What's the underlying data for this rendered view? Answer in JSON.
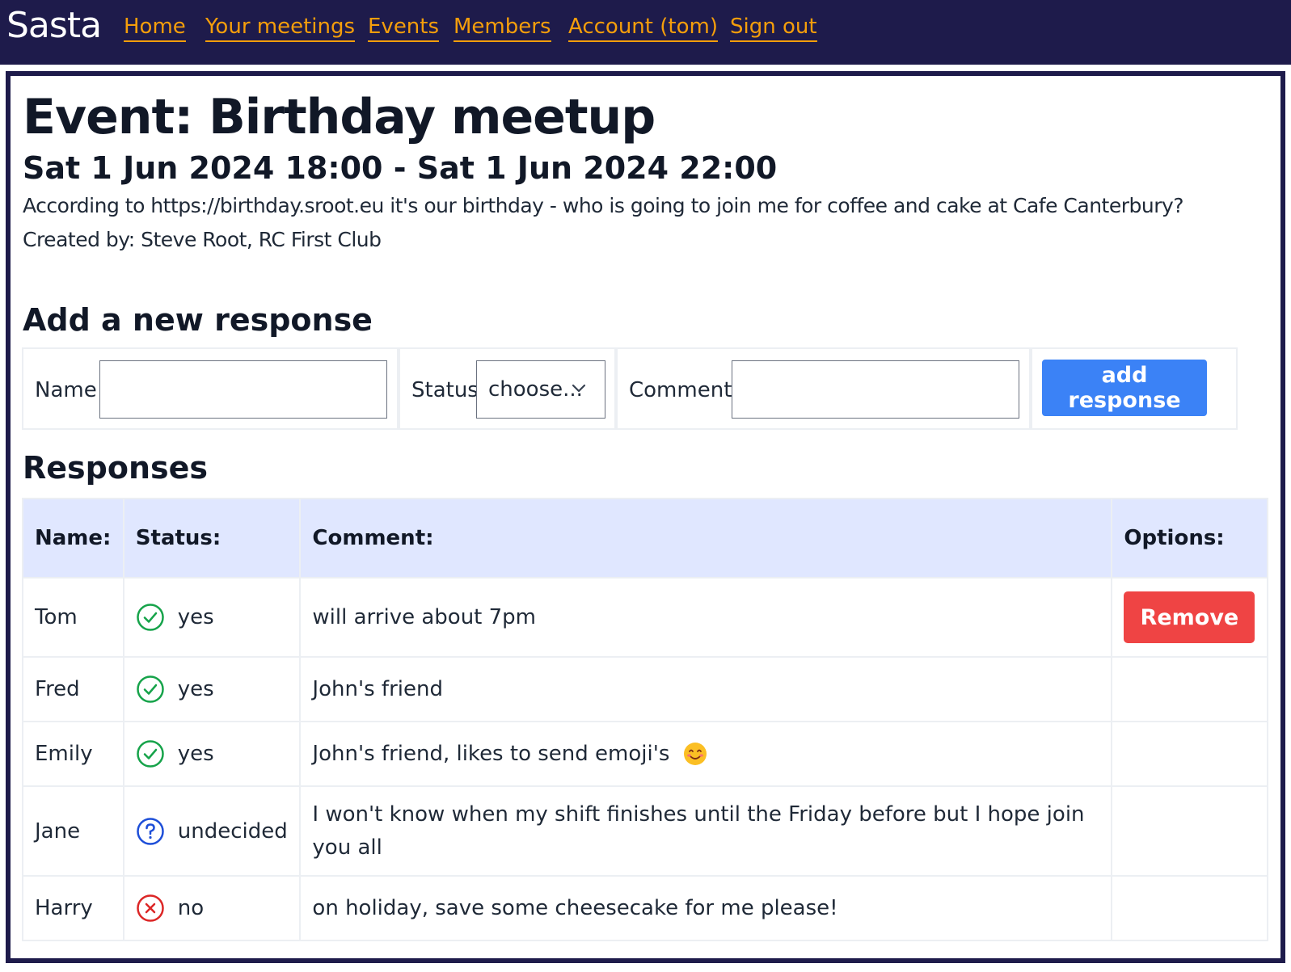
{
  "nav": {
    "brand": "Sasta",
    "links": [
      "Home",
      "Your meetings",
      "Events",
      "Members",
      "Account (tom)",
      "Sign out"
    ]
  },
  "event": {
    "title": "Event: Birthday meetup",
    "dates": "Sat 1 Jun 2024 18:00 - Sat 1 Jun 2024 22:00",
    "description": "According to https://birthday.sroot.eu it's our birthday - who is going to join me for coffee and cake at Cafe Canterbury?",
    "created_by": "Created by: Steve Root, RC First Club"
  },
  "form": {
    "heading": "Add a new response",
    "name_label": "Name",
    "name_value": "",
    "status_label": "Status",
    "status_selected": "choose...",
    "comment_label": "Comment",
    "comment_value": "",
    "submit_label": "add response"
  },
  "responses": {
    "heading": "Responses",
    "headers": [
      "Name:",
      "Status:",
      "Comment:",
      "Options:"
    ],
    "remove_label": "Remove",
    "rows": [
      {
        "name": "Tom",
        "status": "yes",
        "status_icon": "check-circle-icon",
        "comment": "will arrive about 7pm"
      },
      {
        "name": "Fred",
        "status": "yes",
        "status_icon": "check-circle-icon",
        "comment": "John's friend"
      },
      {
        "name": "Emily",
        "status": "yes",
        "status_icon": "check-circle-icon",
        "comment": "John's friend, likes to send emoji's"
      },
      {
        "name": "Jane",
        "status": "undecided",
        "status_icon": "question-circle-icon",
        "comment": "I won't know when my shift finishes until the Friday before but I hope join you all"
      },
      {
        "name": "Harry",
        "status": "no",
        "status_icon": "x-circle-icon",
        "comment": "on holiday, save some cheesecake for me please!"
      }
    ]
  },
  "colors": {
    "navbar_bg": "#1e1b4b",
    "nav_link": "#f59e0b",
    "add_button": "#3b82f6",
    "remove_button": "#ef4444",
    "table_header_bg": "#e0e7ff",
    "yes": "#16a34a",
    "undecided": "#1d4ed8",
    "no": "#dc2626"
  }
}
